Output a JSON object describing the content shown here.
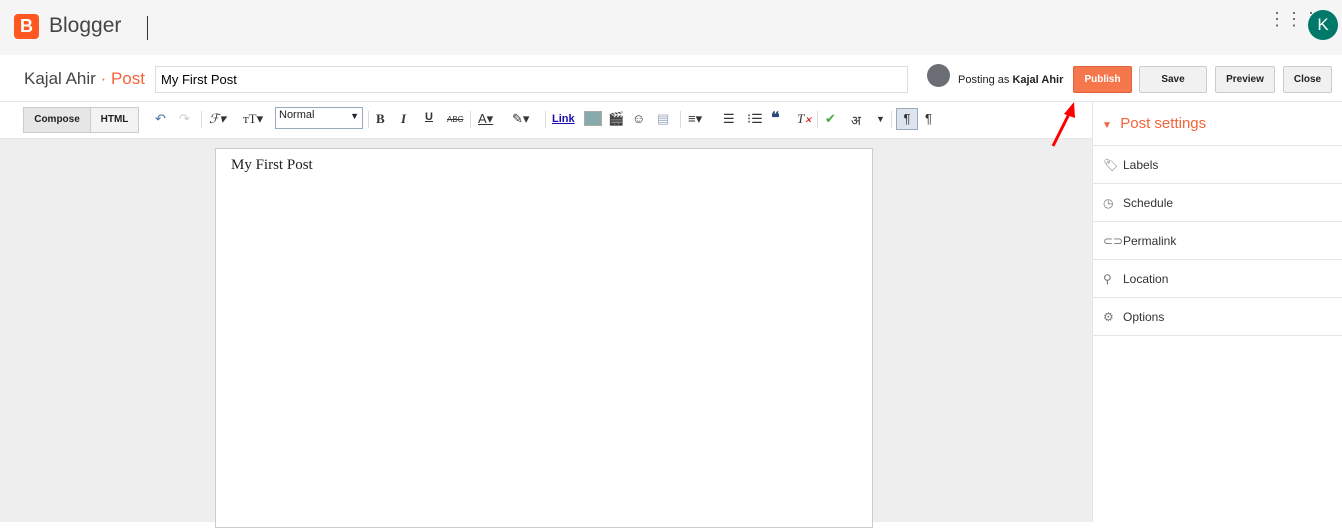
{
  "app": {
    "logo_letter": "B",
    "brand": "Blogger",
    "user_initial": "K"
  },
  "header": {
    "blog_name": "Kajal Ahir",
    "separator": "·",
    "section": "Post",
    "title_value": "My First Post",
    "posting_as_prefix": "Posting as",
    "posting_as_user": "Kajal Ahir",
    "publish": "Publish",
    "save": "Save",
    "preview": "Preview",
    "close": "Close",
    "accent": "#f5774b"
  },
  "toolbar": {
    "compose": "Compose",
    "html": "HTML",
    "format_value": "Normal",
    "link": "Link",
    "hindi": "अ"
  },
  "editor": {
    "content": "My First Post"
  },
  "sidebar": {
    "title": "Post settings",
    "items": [
      {
        "label": "Labels",
        "icon": "tag-icon"
      },
      {
        "label": "Schedule",
        "icon": "clock-icon"
      },
      {
        "label": "Permalink",
        "icon": "link-icon"
      },
      {
        "label": "Location",
        "icon": "pin-icon"
      },
      {
        "label": "Options",
        "icon": "gear-icon"
      }
    ]
  }
}
